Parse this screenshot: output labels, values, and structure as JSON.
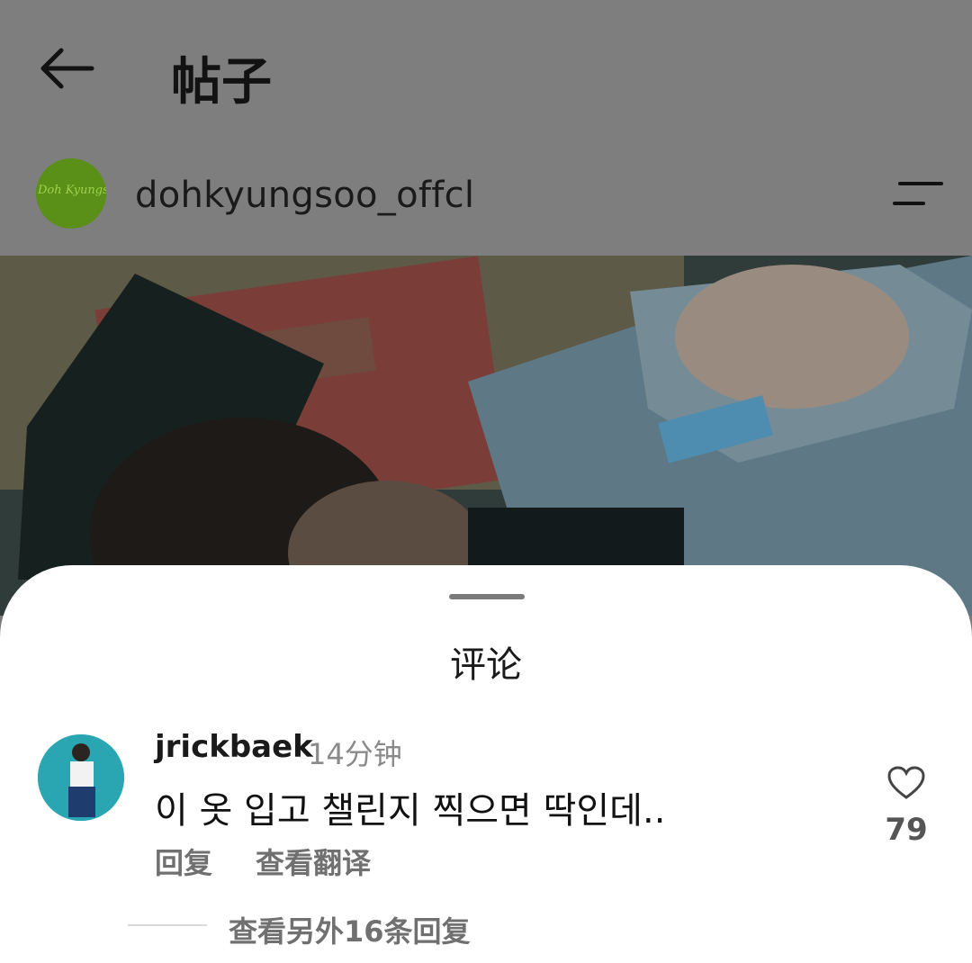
{
  "header": {
    "title": "帖子",
    "back_icon": "arrow-left-icon"
  },
  "post": {
    "author": {
      "username": "dohkyungsoo_offcl",
      "avatar_text": "Doh Kyungsoo",
      "avatar_color": "#5a8f18"
    },
    "menu_icon": "menu-icon"
  },
  "comments_sheet": {
    "title": "评论",
    "comment": {
      "username": "jrickbaek",
      "time": "14分钟",
      "text": "이 옷 입고 챌린지 찍으면 딱인데..",
      "reply_label": "回复",
      "translate_label": "查看翻译",
      "like_count": "79",
      "like_icon": "heart-outline-icon"
    },
    "more_replies_label": "查看另外16条回复"
  },
  "colors": {
    "overlay": "#7e7e7e",
    "sheet": "#ffffff",
    "secondary_text": "#707070"
  }
}
